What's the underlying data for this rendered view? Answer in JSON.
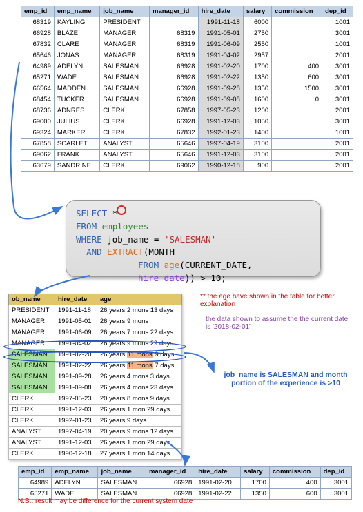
{
  "table1": {
    "headers": [
      "emp_id",
      "emp_name",
      "job_name",
      "manager_id",
      "hire_date",
      "salary",
      "commission",
      "dep_id"
    ],
    "rows": [
      {
        "emp_id": "68319",
        "emp_name": "KAYLING",
        "job_name": "PRESIDENT",
        "manager_id": "",
        "hire_date": "1991-11-18",
        "salary": "6000",
        "commission": "",
        "dep_id": "1001",
        "hl": true
      },
      {
        "emp_id": "66928",
        "emp_name": "BLAZE",
        "job_name": "MANAGER",
        "manager_id": "68319",
        "hire_date": "1991-05-01",
        "salary": "2750",
        "commission": "",
        "dep_id": "3001",
        "hl": true
      },
      {
        "emp_id": "67832",
        "emp_name": "CLARE",
        "job_name": "MANAGER",
        "manager_id": "68319",
        "hire_date": "1991-06-09",
        "salary": "2550",
        "commission": "",
        "dep_id": "1001",
        "hl": true
      },
      {
        "emp_id": "65646",
        "emp_name": "JONAS",
        "job_name": "MANAGER",
        "manager_id": "68319",
        "hire_date": "1991-04-02",
        "salary": "2957",
        "commission": "",
        "dep_id": "2001",
        "hl": true
      },
      {
        "emp_id": "64989",
        "emp_name": "ADELYN",
        "job_name": "SALESMAN",
        "manager_id": "66928",
        "hire_date": "1991-02-20",
        "salary": "1700",
        "commission": "400",
        "dep_id": "3001",
        "hl": true
      },
      {
        "emp_id": "65271",
        "emp_name": "WADE",
        "job_name": "SALESMAN",
        "manager_id": "66928",
        "hire_date": "1991-02-22",
        "salary": "1350",
        "commission": "600",
        "dep_id": "3001",
        "hl": true
      },
      {
        "emp_id": "66564",
        "emp_name": "MADDEN",
        "job_name": "SALESMAN",
        "manager_id": "66928",
        "hire_date": "1991-09-28",
        "salary": "1350",
        "commission": "1500",
        "dep_id": "3001",
        "hl": true
      },
      {
        "emp_id": "68454",
        "emp_name": "TUCKER",
        "job_name": "SALESMAN",
        "manager_id": "66928",
        "hire_date": "1991-09-08",
        "salary": "1600",
        "commission": "0",
        "dep_id": "3001",
        "hl": true
      },
      {
        "emp_id": "68736",
        "emp_name": "ADNRES",
        "job_name": "CLERK",
        "manager_id": "67858",
        "hire_date": "1997-05-23",
        "salary": "1200",
        "commission": "",
        "dep_id": "2001",
        "hl": true
      },
      {
        "emp_id": "69000",
        "emp_name": "JULIUS",
        "job_name": "CLERK",
        "manager_id": "66928",
        "hire_date": "1991-12-03",
        "salary": "1050",
        "commission": "",
        "dep_id": "3001",
        "hl": true
      },
      {
        "emp_id": "69324",
        "emp_name": "MARKER",
        "job_name": "CLERK",
        "manager_id": "67832",
        "hire_date": "1992-01-23",
        "salary": "1400",
        "commission": "",
        "dep_id": "1001",
        "hl": true
      },
      {
        "emp_id": "67858",
        "emp_name": "SCARLET",
        "job_name": "ANALYST",
        "manager_id": "65646",
        "hire_date": "1997-04-19",
        "salary": "3100",
        "commission": "",
        "dep_id": "2001",
        "hl": true
      },
      {
        "emp_id": "69062",
        "emp_name": "FRANK",
        "job_name": "ANALYST",
        "manager_id": "65646",
        "hire_date": "1991-12-03",
        "salary": "3100",
        "commission": "",
        "dep_id": "2001",
        "hl": true
      },
      {
        "emp_id": "63679",
        "emp_name": "SANDRINE",
        "job_name": "CLERK",
        "manager_id": "69062",
        "hire_date": "1990-12-18",
        "salary": "900",
        "commission": "",
        "dep_id": "2001",
        "hl": true
      }
    ]
  },
  "sql": {
    "select": "SELECT",
    "star": "*",
    "from": "FROM",
    "employees": "employees",
    "where": "WHERE",
    "jobname": "job_name",
    "eq": " = ",
    "salesman": "'SALESMAN'",
    "and": "AND",
    "extract": "EXTRACT",
    "month_open": "(MONTH",
    "from2": "FROM",
    "age": "age",
    "curdate": "(CURRENT_DATE, ",
    "hiredate": "hire_date",
    "close": ")) > 10;"
  },
  "table2": {
    "headers": [
      "ob_name",
      "hire_date",
      "age"
    ],
    "rows": [
      {
        "job": "PRESIDENT",
        "hire": "1991-11-18",
        "age": "26 years 2 mons 13 days"
      },
      {
        "job": "MANAGER",
        "hire": "1991-05-01",
        "age": "26 years 9 mons"
      },
      {
        "job": "MANAGER",
        "hire": "1991-06-09",
        "age": "26 years 7 mons 22 days"
      },
      {
        "job": "MANAGER",
        "hire": "1991-04-02",
        "age": "26 years 9 mons 29 days"
      },
      {
        "job": "SALESMAN",
        "hire": "1991-02-20",
        "age_pre": "26 years ",
        "age_hl": "11 mons",
        "age_post": " 9 days",
        "green": true,
        "orangepart": true
      },
      {
        "job": "SALESMAN",
        "hire": "1991-02-22",
        "age_pre": "26 years ",
        "age_hl": "11 mons",
        "age_post": " 7 days",
        "green": true,
        "orangepart": true
      },
      {
        "job": "SALESMAN",
        "hire": "1991-09-28",
        "age": "26 years 4 mons 3 days",
        "green": true
      },
      {
        "job": "SALESMAN",
        "hire": "1991-09-08",
        "age": "26 years 4 mons 23 days",
        "green": true
      },
      {
        "job": "CLERK",
        "hire": "1997-05-23",
        "age": "20 years 8 mons 9 days"
      },
      {
        "job": "CLERK",
        "hire": "1991-12-03",
        "age": "26 years 1 mon 29 days"
      },
      {
        "job": "CLERK",
        "hire": "1992-01-23",
        "age": "26 years 9 days"
      },
      {
        "job": "ANALYST",
        "hire": "1997-04-19",
        "age": "20 years 9 mons 12 days"
      },
      {
        "job": "ANALYST",
        "hire": "1991-12-03",
        "age": "26 years 1 mon 29 days"
      },
      {
        "job": "CLERK",
        "hire": "1990-12-18",
        "age": "27 years 1 mon 14 days"
      }
    ]
  },
  "notes": {
    "red1": "** the age have shown in the table for better explanation",
    "purple": "the data shown to assume the the current date is '2018-02-01'",
    "blue": "job_name is SALESMAN and month portion of the experience is >10"
  },
  "table3": {
    "headers": [
      "emp_id",
      "emp_name",
      "job_name",
      "manager_id",
      "hire_date",
      "salary",
      "commission",
      "dep_id"
    ],
    "rows": [
      {
        "emp_id": "64989",
        "emp_name": "ADELYN",
        "job_name": "SALESMAN",
        "manager_id": "66928",
        "hire_date": "1991-02-20",
        "salary": "1700",
        "commission": "400",
        "dep_id": "3001"
      },
      {
        "emp_id": "65271",
        "emp_name": "WADE",
        "job_name": "SALESMAN",
        "manager_id": "66928",
        "hire_date": "1991-02-22",
        "salary": "1350",
        "commission": "600",
        "dep_id": "3001"
      }
    ]
  },
  "nb": "N.B.: result may be difference for the current system date"
}
